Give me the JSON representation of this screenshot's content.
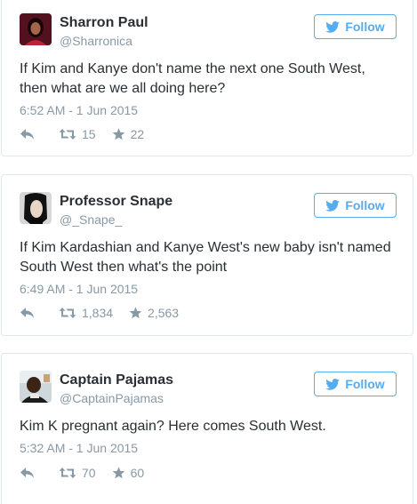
{
  "colors": {
    "twitter_blue": "#55acee",
    "text": "#292f33",
    "muted": "#8899a6",
    "border": "#e1e8ed"
  },
  "tweets": [
    {
      "name": "Sharron Paul",
      "handle": "@Sharronica",
      "follow_label": "Follow",
      "text": "If Kim and Kanye don't name the next one South West, then what are we all doing here?",
      "time": "6:52 AM - 1 Jun 2015",
      "retweets": "15",
      "favorites": "22"
    },
    {
      "name": "Professor Snape",
      "handle": "@_Snape_",
      "follow_label": "Follow",
      "text": "If Kim Kardashian and Kanye West's new baby isn't named South West then what's the point",
      "time": "6:49 AM - 1 Jun 2015",
      "retweets": "1,834",
      "favorites": "2,563"
    },
    {
      "name": "Captain Pajamas",
      "handle": "@CaptainPajamas",
      "follow_label": "Follow",
      "text": "Kim K pregnant again? Here comes South West.",
      "time": "5:32 AM - 1 Jun 2015",
      "retweets": "70",
      "favorites": "60"
    }
  ],
  "icons": {
    "follow": "twitter-bird-icon",
    "reply": "reply-arrow-icon",
    "retweet": "retweet-icon",
    "favorite": "star-icon"
  }
}
